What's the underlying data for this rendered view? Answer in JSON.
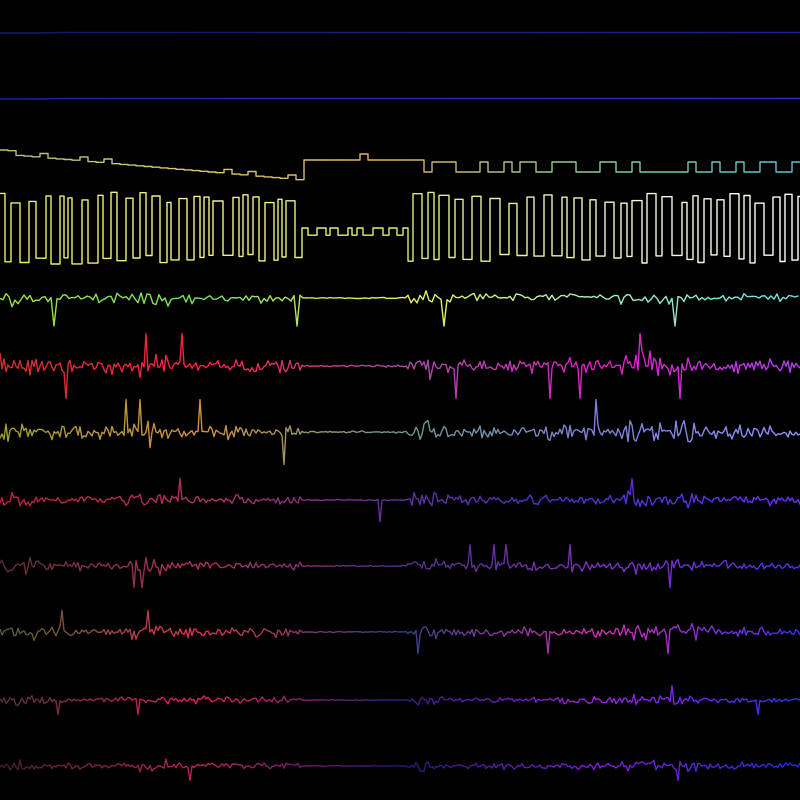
{
  "background": "#000000",
  "traces": [
    {
      "name": "trace-1",
      "palette": [
        "#101a66",
        "#141f80",
        "#1a2499"
      ],
      "style": "flat"
    },
    {
      "name": "trace-2",
      "palette": [
        "#1b1fa8",
        "#2226c0",
        "#2a2ed6"
      ],
      "style": "flat"
    },
    {
      "name": "trace-3",
      "palette": [
        "#a8c878",
        "#d9c870",
        "#e0b060",
        "#80d0a0",
        "#60c0d0"
      ],
      "style": "step-slow"
    },
    {
      "name": "trace-4",
      "palette": [
        "#e8f060",
        "#f4f48a",
        "#d8f070",
        "#f6f6c8",
        "#ffffff"
      ],
      "style": "square-wave"
    },
    {
      "name": "trace-5",
      "palette": [
        "#a0e048",
        "#78e060",
        "#f0f050",
        "#a0f0c0",
        "#70e0e0"
      ],
      "style": "spiky-square"
    },
    {
      "name": "trace-6",
      "palette": [
        "#d03030",
        "#ff2040",
        "#a050a0",
        "#e020c0",
        "#b040f0"
      ],
      "style": "noise-high"
    },
    {
      "name": "trace-7",
      "palette": [
        "#a0a030",
        "#d09040",
        "#6a9a8a",
        "#8080d8",
        "#9090ff"
      ],
      "style": "noise-high"
    },
    {
      "name": "trace-8",
      "palette": [
        "#c02040",
        "#b03060",
        "#6030a0",
        "#5030d0",
        "#6a30ff"
      ],
      "style": "noise-mid"
    },
    {
      "name": "trace-9",
      "palette": [
        "#5a3030",
        "#b03060",
        "#503080",
        "#8030c0",
        "#5030f0"
      ],
      "style": "noise-mid"
    },
    {
      "name": "trace-10",
      "palette": [
        "#4a6030",
        "#e03050",
        "#304080",
        "#d030b0",
        "#4030f0"
      ],
      "style": "noise-mid"
    },
    {
      "name": "trace-11",
      "palette": [
        "#503040",
        "#e02060",
        "#302080",
        "#a020e0",
        "#3030f0"
      ],
      "style": "noise-low"
    },
    {
      "name": "trace-12",
      "palette": [
        "#402030",
        "#c02060",
        "#281870",
        "#8020d0",
        "#2828e0"
      ],
      "style": "noise-low"
    }
  ]
}
